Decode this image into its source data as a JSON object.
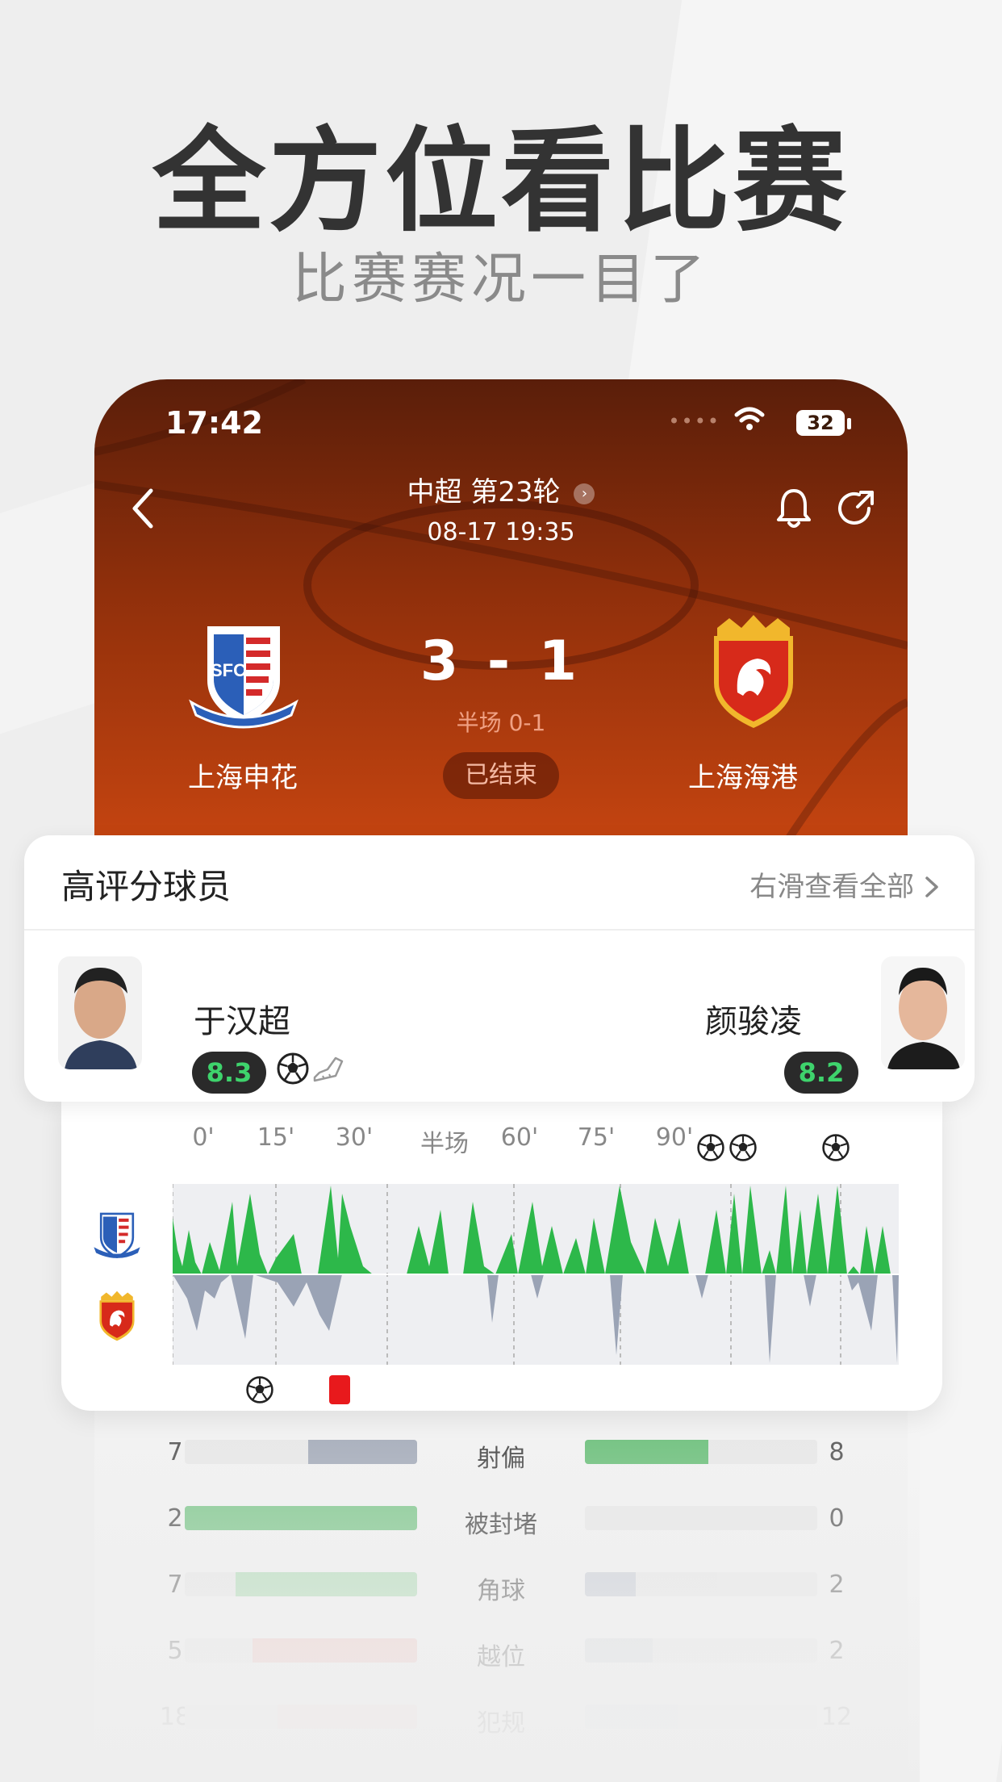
{
  "headline": "全方位看比赛",
  "subheadline": "比赛赛况一目了",
  "status_bar": {
    "time": "17:42",
    "battery": "32",
    "signal_icon": "signal-dots-icon",
    "wifi_icon": "wifi-icon"
  },
  "match": {
    "league": "中超 第23轮",
    "datetime": "08-17 19:35",
    "home_team": "上海申花",
    "away_team": "上海海港",
    "score": "3  -  1",
    "halftime": "半场 0-1",
    "status": "已结束",
    "colors": {
      "header_top": "#5a1e0a",
      "header_bottom": "#c44410"
    }
  },
  "ratings": {
    "title": "高评分球员",
    "more_label": "右滑查看全部",
    "home_player": {
      "name": "于汉超",
      "rating": "8.3",
      "icons": [
        "football-icon",
        "boot-icon"
      ]
    },
    "away_player": {
      "name": "颜骏凌",
      "rating": "8.2"
    },
    "rating_color": "#3ed36c"
  },
  "momentum": {
    "axis_labels": [
      "0'",
      "15'",
      "30'",
      "半场",
      "60'",
      "75'",
      "90'"
    ],
    "home_color": "#2db84a",
    "away_color": "#9aa3b5",
    "home_goal_minutes": [
      81,
      84,
      96
    ],
    "away_goal_minutes": [
      12
    ],
    "away_red_card_minute": [
      23
    ]
  },
  "stats": [
    {
      "label": "射偏",
      "left": "7",
      "right": "8",
      "left_ratio": 0.47,
      "right_ratio": 0.53,
      "left_color": "#a5acba",
      "right_color": "#6cc07b"
    },
    {
      "label": "被封堵",
      "left": "2",
      "right": "0",
      "left_ratio": 1.0,
      "right_ratio": 0.0,
      "left_color": "#7cc68a",
      "right_color": "#d9d9d9"
    },
    {
      "label": "角球",
      "left": "7",
      "right": "2",
      "left_ratio": 0.78,
      "right_ratio": 0.22,
      "left_color": "#a6d8ae",
      "right_color": "#c5c9d3"
    },
    {
      "label": "越位",
      "left": "5",
      "right": "2",
      "left_ratio": 0.71,
      "right_ratio": 0.29,
      "left_color": "#f0b8b4",
      "right_color": "#d2d5dc"
    },
    {
      "label": "犯规",
      "left": "18",
      "right": "12",
      "left_ratio": 0.6,
      "right_ratio": 0.4,
      "left_color": "#f3c6c2",
      "right_color": "#dadde2"
    }
  ]
}
